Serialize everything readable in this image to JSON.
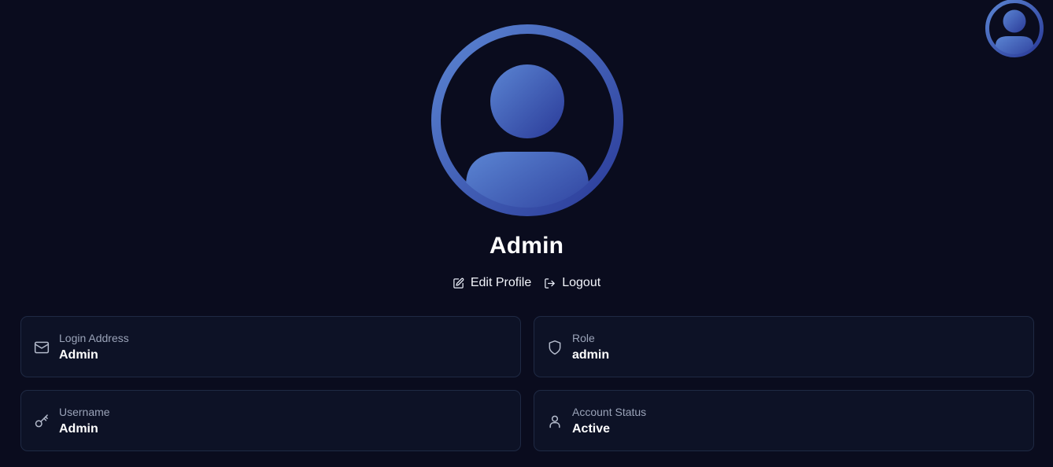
{
  "header": {
    "avatar_icon": "user-avatar-icon"
  },
  "profile": {
    "avatar_icon": "user-avatar-icon",
    "name": "Admin",
    "actions": {
      "edit_label": "Edit Profile",
      "edit_icon": "edit-icon",
      "logout_label": "Logout",
      "logout_icon": "logout-icon"
    }
  },
  "details": {
    "login_address": {
      "label": "Login Address",
      "value": "Admin",
      "icon": "mail-icon"
    },
    "role": {
      "label": "Role",
      "value": "admin",
      "icon": "shield-icon"
    },
    "username": {
      "label": "Username",
      "value": "Admin",
      "icon": "key-icon"
    },
    "account_status": {
      "label": "Account Status",
      "value": "Active",
      "icon": "user-icon"
    }
  },
  "colors": {
    "background": "#0a0c1e",
    "card_background": "#0d1226",
    "card_border": "#1f2a44",
    "avatar_gradient_start": "#5b85d3",
    "avatar_gradient_end": "#2a3a98",
    "muted_text": "#9aa3b8"
  }
}
